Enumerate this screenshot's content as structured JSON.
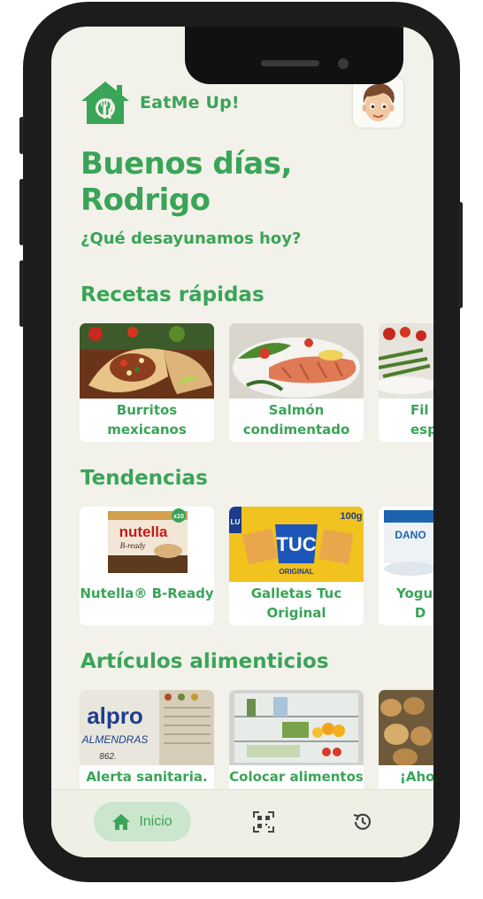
{
  "app": {
    "name": "EatMe Up!"
  },
  "greeting": {
    "line1": "Buenos días,",
    "line2": "Rodrigo",
    "question": "¿Qué desayunamos hoy?"
  },
  "sections": {
    "quick_recipes": {
      "title": "Recetas rápidas",
      "items": [
        {
          "label": "Burritos mexicanos"
        },
        {
          "label": "Salmón condimentado"
        },
        {
          "label": "Filete con espárragos",
          "visible_label": "Fil esp"
        }
      ]
    },
    "trends": {
      "title": "Tendencias",
      "items": [
        {
          "label": "Nutella® B-Ready",
          "brand": "nutella",
          "sub": "B-ready",
          "badge": "x10"
        },
        {
          "label": "Galletas Tuc Original",
          "brand": "TUC",
          "badge": "100g",
          "corner": "LU",
          "sub": "ORIGINAL"
        },
        {
          "label": "Yogur Danone",
          "visible_label": "Yogu D",
          "brand": "DANO"
        }
      ]
    },
    "articles": {
      "title": "Artículos alimenticios",
      "items": [
        {
          "label": "Alerta sanitaria.",
          "brand": "alpro",
          "sub": "ALMENDRAS",
          "code": "862."
        },
        {
          "label": "Colocar alimentos"
        },
        {
          "label": "¡Aho"
        }
      ]
    }
  },
  "nav": {
    "home_label": "Inicio",
    "items": [
      "home",
      "qr-scan",
      "history"
    ]
  },
  "colors": {
    "accent": "#3aa457",
    "background": "#f2f2ea",
    "pill": "#cce6cd"
  }
}
